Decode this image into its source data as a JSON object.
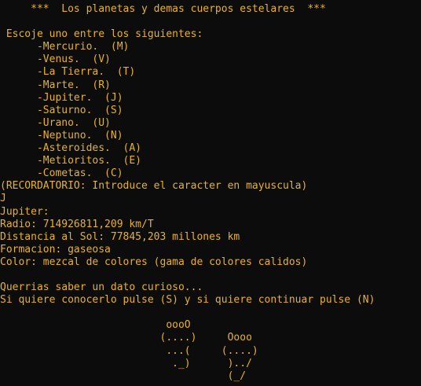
{
  "colors": {
    "background": "#0c0c0c",
    "foreground": "#e8b325"
  },
  "terminal": {
    "lines": [
      "     ***  Los planetas y demas cuerpos estelares  ***",
      "",
      " Escoje uno entre los siguientes:",
      "      -Mercurio.  (M)",
      "      -Venus.  (V)",
      "      -La Tierra.  (T)",
      "      -Marte.  (R)",
      "      -Jupiter.  (J)",
      "      -Saturno.  (S)",
      "      -Urano.  (U)",
      "      -Neptuno.  (N)",
      "      -Asteroides.  (A)",
      "      -Metioritos.  (E)",
      "      -Cometas.  (C)",
      "(RECORDATORIO: Introduce el caracter en mayuscula)",
      "J",
      "Jupiter:",
      "Radio: 714926811,209 km/T",
      "Distancia al Sol: 77845,203 millones km",
      "Formacion: gaseosa",
      "Color: mezcal de colores (gama de colores calidos)",
      "",
      "Querrias saber un dato curioso...",
      "Si quiere conocerlo pulse (S) y si quiere continuar pulse (N)",
      "",
      "                           oooO",
      "                          (....)     Oooo",
      "                           ...(     (....)",
      "                            ._)      )../",
      "                                     (_/"
    ]
  }
}
